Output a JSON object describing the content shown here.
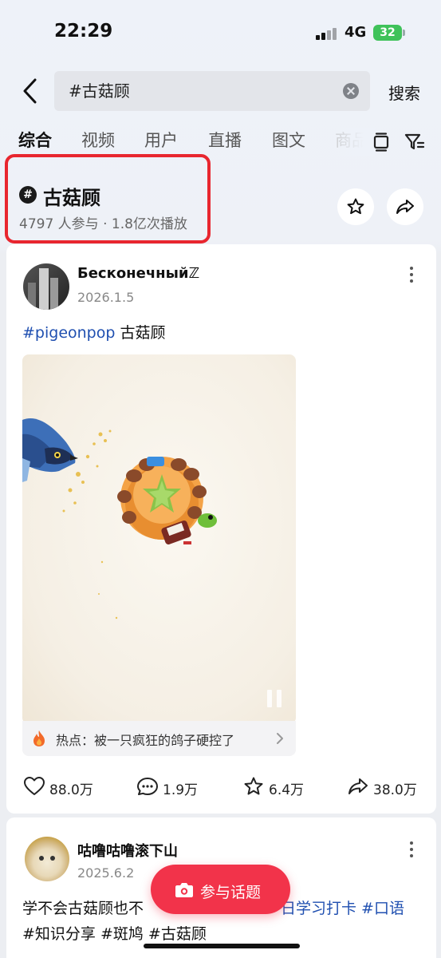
{
  "status_bar": {
    "time": "22:29",
    "network": "4G",
    "battery": "32"
  },
  "search": {
    "query": "#古菇顾",
    "submit_label": "搜索"
  },
  "tabs": [
    {
      "label": "综合",
      "active": true
    },
    {
      "label": "视频"
    },
    {
      "label": "用户"
    },
    {
      "label": "直播"
    },
    {
      "label": "图文"
    },
    {
      "label": "商品"
    }
  ],
  "topic": {
    "icon": "#",
    "title": "古菇顾",
    "stats": "4797 人参与 · 1.8亿次播放"
  },
  "post1": {
    "author": "Бесконечныйℤ",
    "date": "2026.1.5",
    "hashtag": "#pigeonpop",
    "text": " 古菇顾",
    "hot_text": "热点：被一只疯狂的鸽子硬控了",
    "likes": "88.0万",
    "comments": "1.9万",
    "favorites": "6.4万",
    "shares": "38.0万"
  },
  "post2": {
    "author": "咕噜咕噜滚下山",
    "date": "2025.6.2",
    "line1_text": "学不会古菇顾也不",
    "line1_tags": "日学习打卡 #口语",
    "line2_tags": "#知识分享 #斑鸠 #古菇顾"
  },
  "join_button": {
    "label": "参与话题"
  },
  "colors": {
    "accent": "#f2334a",
    "hashtag": "#1f4fb0",
    "highlight": "#e8262f"
  }
}
